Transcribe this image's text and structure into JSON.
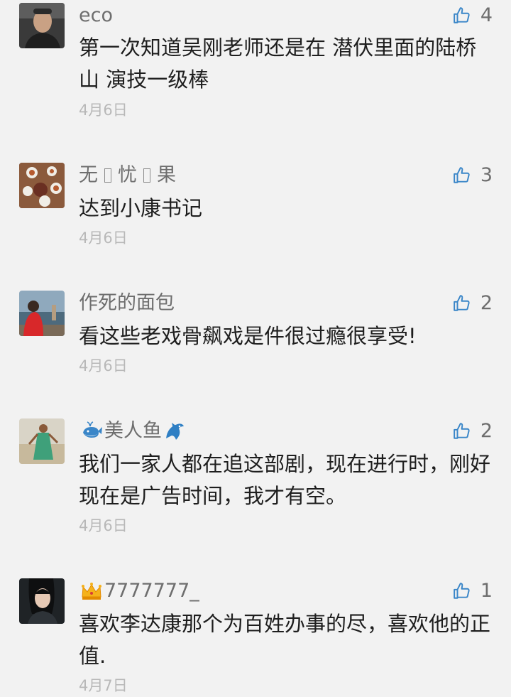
{
  "comments": [
    {
      "username": "eco",
      "likes": "4",
      "content": "第一次知道吴刚老师还是在 潜伏里面的陆桥山 演技一级棒",
      "date": "4月6日"
    },
    {
      "username_parts": [
        "无",
        "忧",
        "果"
      ],
      "likes": "3",
      "content": "达到小康书记",
      "date": "4月6日"
    },
    {
      "username": "作死的面包",
      "likes": "2",
      "content": "看这些老戏骨飙戏是件很过瘾很享受!",
      "date": "4月6日"
    },
    {
      "username": "美人鱼",
      "username_prefix_icon": "whale-emoji-icon",
      "username_suffix_icon": "dolphin-emoji-icon",
      "likes": "2",
      "content": "我们一家人都在追这部剧，现在进行时，刚好现在是广告时间，我才有空。",
      "date": "4月6日"
    },
    {
      "username": "7777777_",
      "username_prefix_icon": "crown-emoji-icon",
      "likes": "1",
      "content": "喜欢李达康那个为百姓办事的尽，喜欢他的正值.",
      "date": "4月7日"
    }
  ],
  "icons": {
    "like": "thumbs-up-icon"
  },
  "colors": {
    "background": "#f2f2f2",
    "username": "#6e6e6e",
    "content": "#1e1e1e",
    "date": "#b8b8b8",
    "like_icon": "#3a86c8"
  }
}
